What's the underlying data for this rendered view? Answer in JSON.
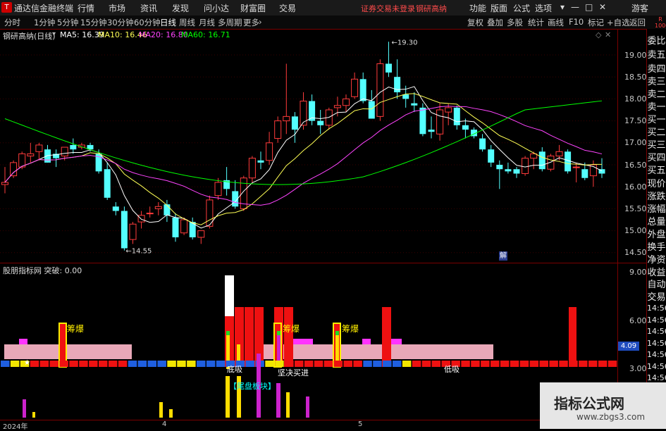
{
  "titlebar": {
    "app_name": "通达信金融终端",
    "menu": [
      "行情",
      "市场",
      "资讯",
      "发现",
      "问小达",
      "财富圈",
      "交易"
    ],
    "warning": "证券交易未登录",
    "stock_name": "钢研高纳",
    "right_menu": [
      "功能",
      "版面",
      "公式",
      "选项"
    ],
    "guest": "游客"
  },
  "toolbar": {
    "periods": [
      "分时",
      "1分钟",
      "5分钟",
      "15分钟",
      "30分钟",
      "60分钟",
      "日线",
      "周线",
      "月线",
      "多周期",
      "更多"
    ],
    "active_period": "日线",
    "right_buttons": [
      "复权",
      "叠加",
      "多股",
      "统计",
      "画线",
      "F10",
      "标记",
      "+自选",
      "返回"
    ]
  },
  "main_chart": {
    "header_stock": "钢研高纳(日线)",
    "ma5_label": "MA5: 16.39",
    "ma10_label": "MA10: 16.46",
    "ma20_label": "MA20: 16.80",
    "ma60_label": "MA60: 16.71",
    "high_label": "19.30",
    "low_label": "14.55",
    "tag": "解",
    "colors": {
      "up": "#ff3b3b",
      "down": "#54ffff",
      "ma5": "#ffffff",
      "ma10": "#ffff55",
      "ma20": "#ff44ff",
      "ma60": "#00ff00"
    }
  },
  "sub_chart": {
    "header": "股朋指标网 突破: 0.00",
    "labels": {
      "chouma1": "筹爆",
      "chouma2": "筹爆",
      "chouma3": "筹爆",
      "left1": "底吸",
      "jianjue": "坚决买进",
      "dixi": "低吸",
      "weipan": "【尾盘板块】"
    },
    "value_badge": "4.09"
  },
  "y_axis_top": [
    "19.00",
    "18.50",
    "18.00",
    "17.50",
    "17.00",
    "16.50",
    "16.00",
    "15.50",
    "15.00",
    "14.50"
  ],
  "y_axis_bottom": [
    "9.00",
    "6.00",
    "3.00"
  ],
  "x_axis": [
    "2024年",
    "4",
    "5"
  ],
  "right_column": {
    "top_labels": [
      "委比",
      "卖五",
      "卖四",
      "卖三",
      "卖二",
      "卖一",
      "买一",
      "买二",
      "买三",
      "买四",
      "买五",
      "现价",
      "涨跌",
      "涨幅",
      "总量",
      "外盘",
      "换手",
      "净资",
      "收益",
      "自动",
      "交易"
    ],
    "times": [
      "14:56",
      "14:56",
      "14:56",
      "14:56",
      "14:56",
      "14:56",
      "14:56",
      "14:56"
    ],
    "corner": "R 1000"
  },
  "chart_data": {
    "type": "candlestick",
    "price_min": 14.3,
    "price_max": 19.6,
    "candles": [
      [
        16.05,
        16.45,
        15.85,
        16.1
      ],
      [
        16.25,
        16.6,
        16.2,
        16.55
      ],
      [
        16.45,
        16.8,
        16.4,
        16.75
      ],
      [
        16.7,
        17.0,
        16.55,
        16.75
      ],
      [
        16.8,
        17.0,
        16.6,
        16.95
      ],
      [
        16.85,
        16.95,
        16.55,
        16.55
      ],
      [
        16.75,
        16.85,
        16.45,
        16.65
      ],
      [
        16.7,
        16.9,
        16.6,
        16.9
      ],
      [
        16.95,
        17.1,
        16.75,
        16.85
      ],
      [
        16.9,
        17.0,
        16.85,
        16.95
      ],
      [
        16.95,
        17.0,
        16.8,
        16.85
      ],
      [
        16.75,
        16.85,
        16.3,
        16.35
      ],
      [
        16.4,
        16.55,
        15.7,
        15.75
      ],
      [
        15.55,
        15.65,
        15.35,
        15.45
      ],
      [
        15.45,
        15.55,
        14.55,
        14.6
      ],
      [
        14.8,
        15.2,
        14.7,
        15.15
      ],
      [
        15.2,
        15.45,
        15.05,
        15.35
      ],
      [
        15.4,
        15.55,
        15.3,
        15.4
      ],
      [
        15.5,
        15.65,
        15.35,
        15.55
      ],
      [
        15.6,
        15.7,
        15.2,
        15.35
      ],
      [
        15.3,
        15.4,
        14.75,
        14.85
      ],
      [
        14.95,
        15.3,
        14.9,
        15.25
      ],
      [
        15.2,
        15.3,
        14.8,
        14.85
      ],
      [
        14.85,
        15.0,
        14.7,
        15.0
      ],
      [
        15.1,
        15.8,
        15.05,
        15.7
      ],
      [
        15.8,
        16.2,
        15.7,
        16.1
      ],
      [
        16.15,
        16.45,
        15.8,
        15.95
      ],
      [
        15.9,
        16.15,
        15.5,
        15.55
      ],
      [
        15.5,
        16.25,
        15.45,
        16.2
      ],
      [
        16.2,
        16.7,
        16.1,
        16.65
      ],
      [
        16.6,
        16.8,
        16.4,
        16.55
      ],
      [
        16.6,
        17.25,
        16.5,
        17.0
      ],
      [
        17.1,
        17.6,
        17.0,
        17.5
      ],
      [
        17.5,
        18.8,
        17.2,
        17.6
      ],
      [
        17.6,
        17.7,
        17.0,
        17.3
      ],
      [
        17.4,
        18.15,
        17.3,
        17.95
      ],
      [
        17.95,
        18.1,
        17.4,
        17.5
      ],
      [
        17.5,
        17.75,
        17.2,
        17.4
      ],
      [
        17.4,
        17.8,
        17.3,
        17.75
      ],
      [
        17.8,
        18.05,
        17.6,
        17.85
      ],
      [
        17.85,
        18.1,
        17.7,
        18.0
      ],
      [
        18.05,
        18.6,
        18.0,
        18.45
      ],
      [
        18.45,
        18.6,
        17.9,
        17.95
      ],
      [
        17.95,
        18.2,
        17.55,
        17.55
      ],
      [
        17.6,
        18.9,
        17.5,
        18.8
      ],
      [
        18.8,
        19.3,
        18.5,
        18.6
      ],
      [
        18.5,
        18.9,
        18.0,
        18.15
      ],
      [
        18.1,
        18.3,
        17.8,
        18.0
      ],
      [
        17.9,
        18.15,
        17.7,
        17.85
      ],
      [
        17.8,
        17.9,
        17.15,
        17.2
      ],
      [
        17.3,
        17.6,
        17.1,
        17.25
      ],
      [
        17.2,
        17.9,
        17.05,
        17.75
      ],
      [
        17.7,
        17.9,
        17.4,
        17.8
      ],
      [
        17.8,
        17.85,
        17.3,
        17.4
      ],
      [
        17.4,
        17.55,
        17.1,
        17.3
      ],
      [
        17.3,
        17.35,
        17.1,
        17.15
      ],
      [
        17.1,
        17.2,
        16.8,
        16.85
      ],
      [
        16.85,
        16.95,
        16.45,
        16.55
      ],
      [
        16.5,
        16.6,
        15.95,
        16.4
      ],
      [
        16.4,
        16.55,
        16.3,
        16.35
      ],
      [
        16.4,
        16.45,
        16.2,
        16.3
      ],
      [
        16.3,
        16.7,
        16.25,
        16.65
      ],
      [
        16.65,
        16.8,
        16.4,
        16.75
      ],
      [
        16.8,
        16.9,
        16.35,
        16.4
      ],
      [
        16.4,
        16.75,
        16.35,
        16.7
      ],
      [
        16.7,
        16.95,
        16.6,
        16.8
      ],
      [
        16.8,
        16.85,
        16.3,
        16.35
      ],
      [
        16.45,
        16.55,
        16.1,
        16.45
      ],
      [
        16.4,
        16.55,
        16.15,
        16.2
      ],
      [
        16.25,
        16.6,
        16.0,
        16.5
      ],
      [
        16.4,
        16.65,
        16.2,
        16.3
      ]
    ]
  }
}
